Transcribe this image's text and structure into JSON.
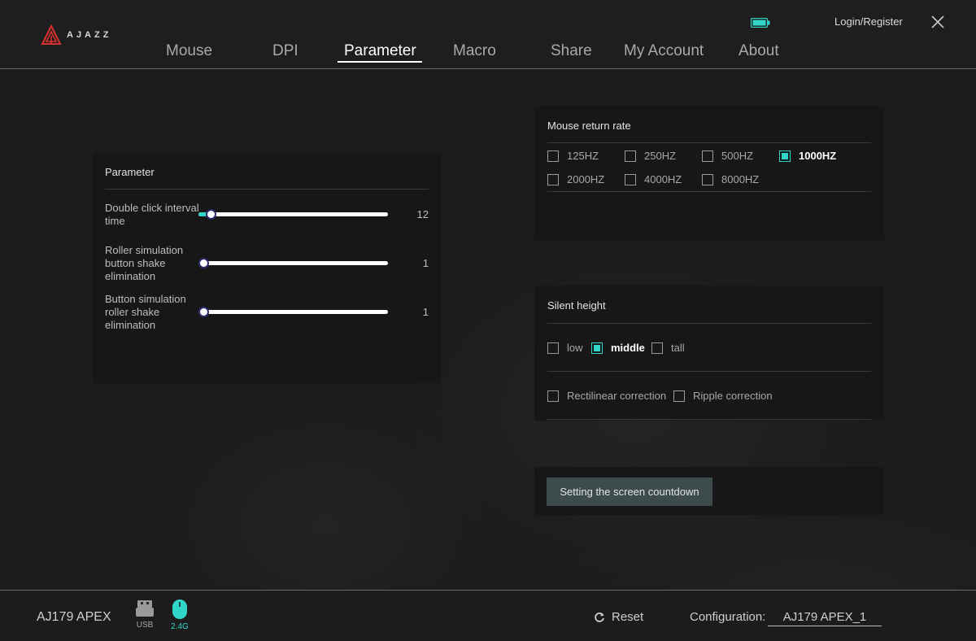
{
  "app": {
    "brand": "AJAZZ",
    "login_label": "Login/Register"
  },
  "nav": {
    "tabs": [
      {
        "label": "Mouse"
      },
      {
        "label": "DPI"
      },
      {
        "label": "Parameter"
      },
      {
        "label": "Macro"
      },
      {
        "label": "Share"
      },
      {
        "label": "My Account"
      },
      {
        "label": "About"
      }
    ],
    "active": "Parameter"
  },
  "parameter": {
    "title": "Parameter",
    "sliders": [
      {
        "label": "Double click interval time",
        "value": "12",
        "fraction": 0.07
      },
      {
        "label": "Roller simulation button shake elimination",
        "value": "1",
        "fraction": 0.0
      },
      {
        "label": "Button simulation roller shake elimination",
        "value": "1",
        "fraction": 0.0
      }
    ]
  },
  "return_rate": {
    "title": "Mouse return rate",
    "options": [
      {
        "label": "125HZ",
        "checked": false
      },
      {
        "label": "250HZ",
        "checked": false
      },
      {
        "label": "500HZ",
        "checked": false
      },
      {
        "label": "1000HZ",
        "checked": true
      },
      {
        "label": "2000HZ",
        "checked": false
      },
      {
        "label": "4000HZ",
        "checked": false
      },
      {
        "label": "8000HZ",
        "checked": false
      }
    ]
  },
  "silent_height": {
    "title": "Silent height",
    "options": [
      {
        "label": "low",
        "checked": false
      },
      {
        "label": "middle",
        "checked": true
      },
      {
        "label": "tall",
        "checked": false
      }
    ],
    "corrections": [
      {
        "label": "Rectilinear correction",
        "checked": false
      },
      {
        "label": "Ripple correction",
        "checked": false
      }
    ]
  },
  "countdown_button": "Setting the screen countdown",
  "footer": {
    "device_name": "AJ179 APEX",
    "usb_label": "USB",
    "wireless_label": "2.4G",
    "reset_label": "Reset",
    "config_label": "Configuration:",
    "config_value": "AJ179 APEX_1"
  },
  "colors": {
    "accent": "#2fd6c9",
    "background": "#1c1c1c",
    "panel": "#171717",
    "logo_red": "#d9322f"
  }
}
